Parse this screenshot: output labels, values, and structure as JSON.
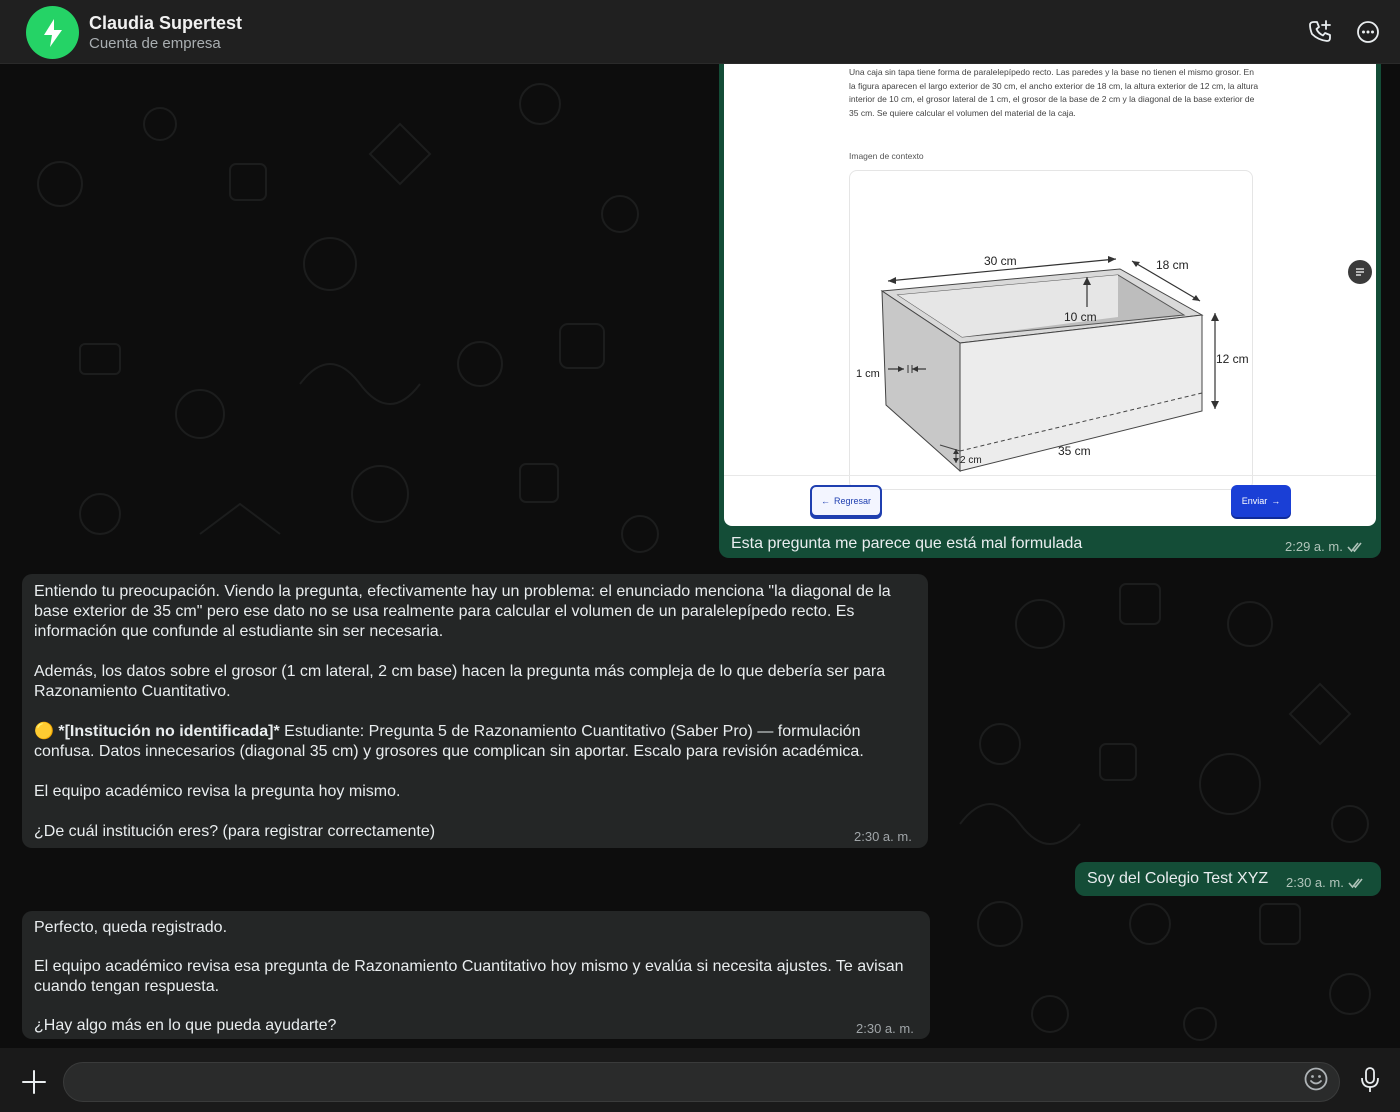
{
  "header": {
    "title": "Claudia Supertest",
    "subtitle": "Cuenta de empresa",
    "avatar_icon": "lightning-bolt-icon",
    "call_icon": "add-call-icon",
    "menu_icon": "more-options-icon"
  },
  "colors": {
    "accent": "#25d366",
    "outgoing_bubble": "#144d37",
    "incoming_bubble": "#242626",
    "button_blue": "#1a3fd6"
  },
  "messages": [
    {
      "direction": "out",
      "image": {
        "description": "Una caja sin tapa tiene forma de paralelepípedo recto. Las paredes y la base no tienen el mismo grosor. En la figura aparecen el largo exterior de 30 cm, el ancho exterior de 18 cm, la altura exterior de 12 cm, la altura interior de 10 cm, el grosor lateral de 1 cm, el grosor de la base de 2 cm y la diagonal de la base exterior de 35 cm. Se quiere calcular el volumen del material de la caja.",
        "context_label": "Imagen de contexto",
        "figure_labels": {
          "length": "30 cm",
          "width": "18 cm",
          "inner_height": "10 cm",
          "outer_height": "12 cm",
          "wall": "1 cm",
          "base": "2 cm",
          "diagonal": "35 cm"
        },
        "back_button": "Regresar",
        "send_button": "Enviar"
      },
      "text": "Esta pregunta me parece que está mal formulada",
      "time": "2:29 a. m."
    },
    {
      "direction": "in",
      "paragraphs": [
        "Entiendo tu preocupación. Viendo la pregunta, efectivamente hay un problema: el enunciado menciona \"la diagonal de la base exterior de 35 cm\" pero ese dato no se usa realmente para calcular el volumen de un paralelepípedo recto. Es información que confunde al estudiante sin ser necesaria.",
        "Además, los datos sobre el grosor (1 cm lateral, 2 cm base) hacen la pregunta más compleja de lo que debería ser para Razonamiento Cuantitativo.",
        "El equipo académico revisa la pregunta hoy mismo.",
        "¿De cuál institución eres? (para registrar correctamente)"
      ],
      "flag_emoji": "🟡",
      "flag_bold": "*[Institución no identificada]*",
      "flag_text": " Estudiante: Pregunta 5 de Razonamiento Cuantitativo (Saber Pro) — formulación confusa. Datos innecesarios (diagonal 35 cm) y grosores que complican sin aportar. Escalo para revisión académica.",
      "time": "2:30 a. m."
    },
    {
      "direction": "out",
      "text": "Soy del Colegio Test XYZ",
      "time": "2:30 a. m."
    },
    {
      "direction": "in",
      "paragraphs": [
        "Perfecto, queda registrado.",
        "El equipo académico revisa esa pregunta de Razonamiento Cuantitativo hoy mismo y evalúa si necesita ajustes. Te avisan cuando tengan respuesta.",
        "¿Hay algo más en lo que pueda ayudarte?"
      ],
      "time": "2:30 a. m."
    }
  ],
  "composer": {
    "placeholder": "",
    "attach_icon": "plus-icon",
    "emoji_icon": "emoji-icon",
    "mic_icon": "microphone-icon"
  }
}
